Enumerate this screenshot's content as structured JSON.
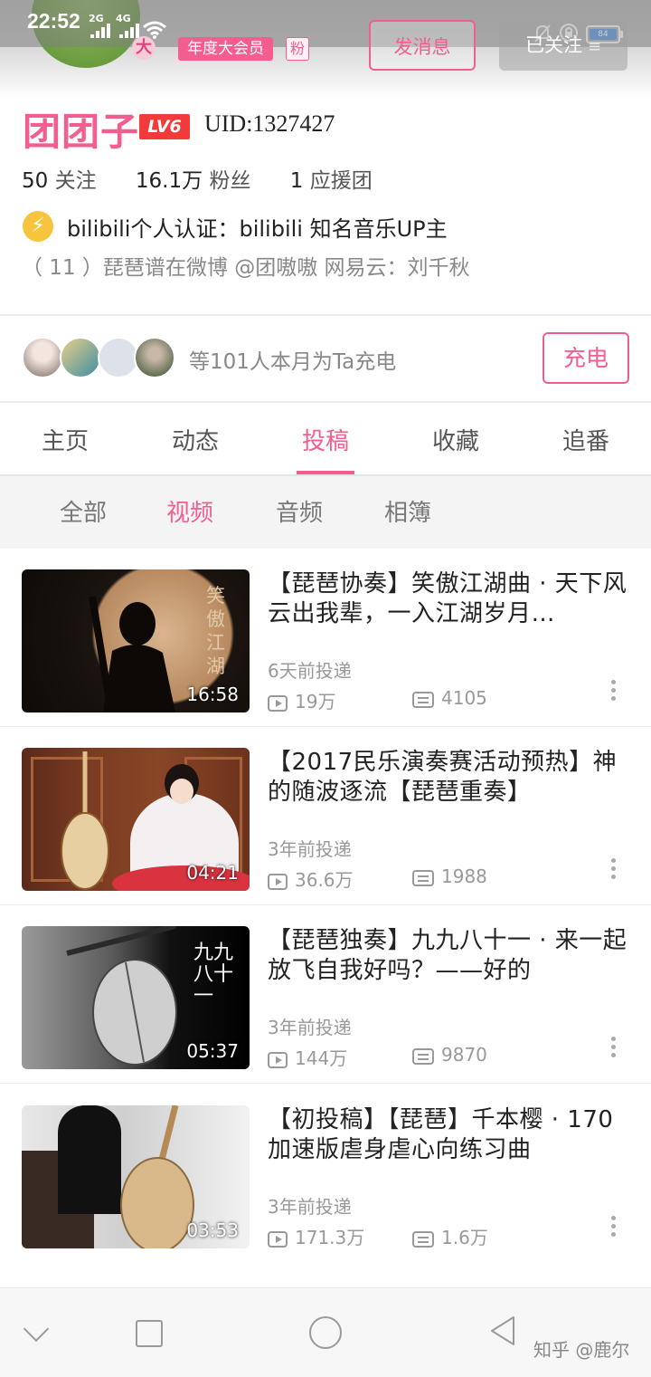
{
  "colors": {
    "accent": "#f45d90",
    "level_badge": "#f33a3a",
    "cert": "#f7c53d"
  },
  "status_bar": {
    "time": "22:52",
    "signal_label_1": "2G",
    "signal_label_2": "4G",
    "battery": "84"
  },
  "header": {
    "member_badge": "年度大会员",
    "fan_badge": "粉",
    "message_button": "发消息",
    "follow_button": "已关注",
    "follow_menu_icon": "≡"
  },
  "profile": {
    "name": "团团子",
    "level": "LV6",
    "uid": "UID:1327427",
    "following_count": "50",
    "following_label": "关注",
    "fans_count": "16.1万",
    "fans_label": "粉丝",
    "support_count": "1",
    "support_label": "应援团",
    "certification": "bilibili个人认证：bilibili 知名音乐UP主",
    "bio": "（ 11 ）琵琶谱在微博 @团嗷嗷 网易云：刘千秋"
  },
  "charge": {
    "text": "等101人本月为Ta充电",
    "button": "充电"
  },
  "tabs": [
    "主页",
    "动态",
    "投稿",
    "收藏",
    "追番"
  ],
  "active_tab": "投稿",
  "subtabs": [
    "全部",
    "视频",
    "音频",
    "相簿"
  ],
  "active_subtab": "视频",
  "videos": [
    {
      "title": "【琵琶协奏】笑傲江湖曲 · 天下风云出我辈，一入江湖岁月…",
      "duration": "16:58",
      "posted": "6天前投递",
      "plays": "19万",
      "comments": "4105",
      "thumb_text": "笑傲江湖"
    },
    {
      "title": "【2017民乐演奏赛活动预热】神的随波逐流【琵琶重奏】",
      "duration": "04:21",
      "posted": "3年前投递",
      "plays": "36.6万",
      "comments": "1988",
      "thumb_text": ""
    },
    {
      "title": "【琵琶独奏】九九八十一 · 来一起放飞自我好吗？——好的",
      "duration": "05:37",
      "posted": "3年前投递",
      "plays": "144万",
      "comments": "9870",
      "thumb_text": "九九八十一"
    },
    {
      "title": "【初投稿】【琵琶】千本樱 · 170加速版虐身虐心向练习曲",
      "duration": "03:53",
      "posted": "3年前投递",
      "plays": "171.3万",
      "comments": "1.6万",
      "thumb_text": ""
    }
  ],
  "watermark": "知乎 @鹿尔"
}
